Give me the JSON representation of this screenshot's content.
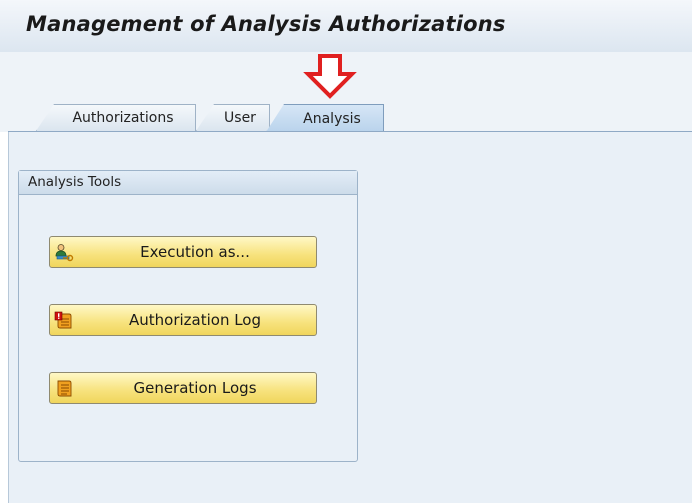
{
  "window": {
    "title": "Management of Analysis Authorizations"
  },
  "tabs": [
    {
      "label": "Authorizations",
      "active": false
    },
    {
      "label": "User",
      "active": false
    },
    {
      "label": "Analysis",
      "active": true
    }
  ],
  "analysis_tools": {
    "header": "Analysis Tools",
    "buttons": [
      {
        "label": "Execution as...",
        "icon": "user-key-icon"
      },
      {
        "label": "Authorization Log",
        "icon": "error-log-icon"
      },
      {
        "label": "Generation Logs",
        "icon": "log-icon"
      }
    ]
  },
  "colors": {
    "button_yellow": "#f7e27c",
    "panel_bg": "#e9f0f7",
    "annotation_arrow": "#e02020"
  }
}
